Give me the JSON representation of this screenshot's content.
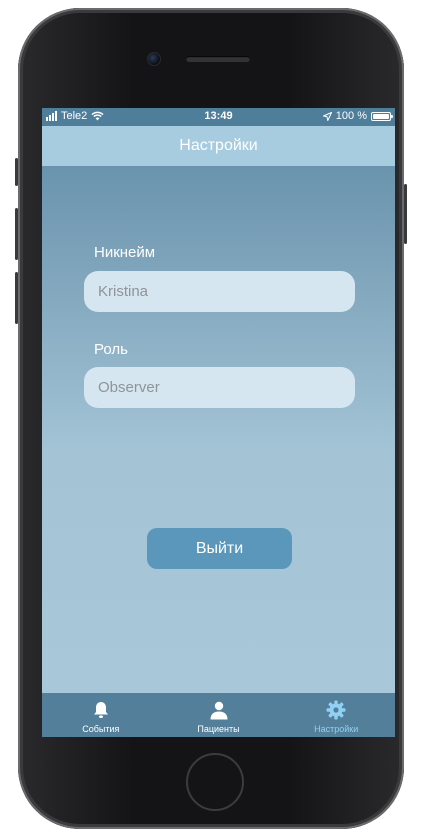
{
  "status_bar": {
    "carrier": "Tele2",
    "time": "13:49",
    "battery": "100 %"
  },
  "nav": {
    "title": "Настройки"
  },
  "form": {
    "nickname_label": "Никнейм",
    "nickname_placeholder": "Kristina",
    "role_label": "Роль",
    "role_placeholder": "Observer"
  },
  "logout_label": "Выйти",
  "tabs": [
    {
      "label": "События",
      "icon": "bell-icon",
      "active": false
    },
    {
      "label": "Пациенты",
      "icon": "person-icon",
      "active": false
    },
    {
      "label": "Настройки",
      "icon": "gear-icon",
      "active": true
    }
  ],
  "colors": {
    "nav_bar": "#a7cbdf",
    "tab_bar": "#547f9a",
    "active_tab": "#8fd0f4",
    "button": "#5b97bb"
  }
}
